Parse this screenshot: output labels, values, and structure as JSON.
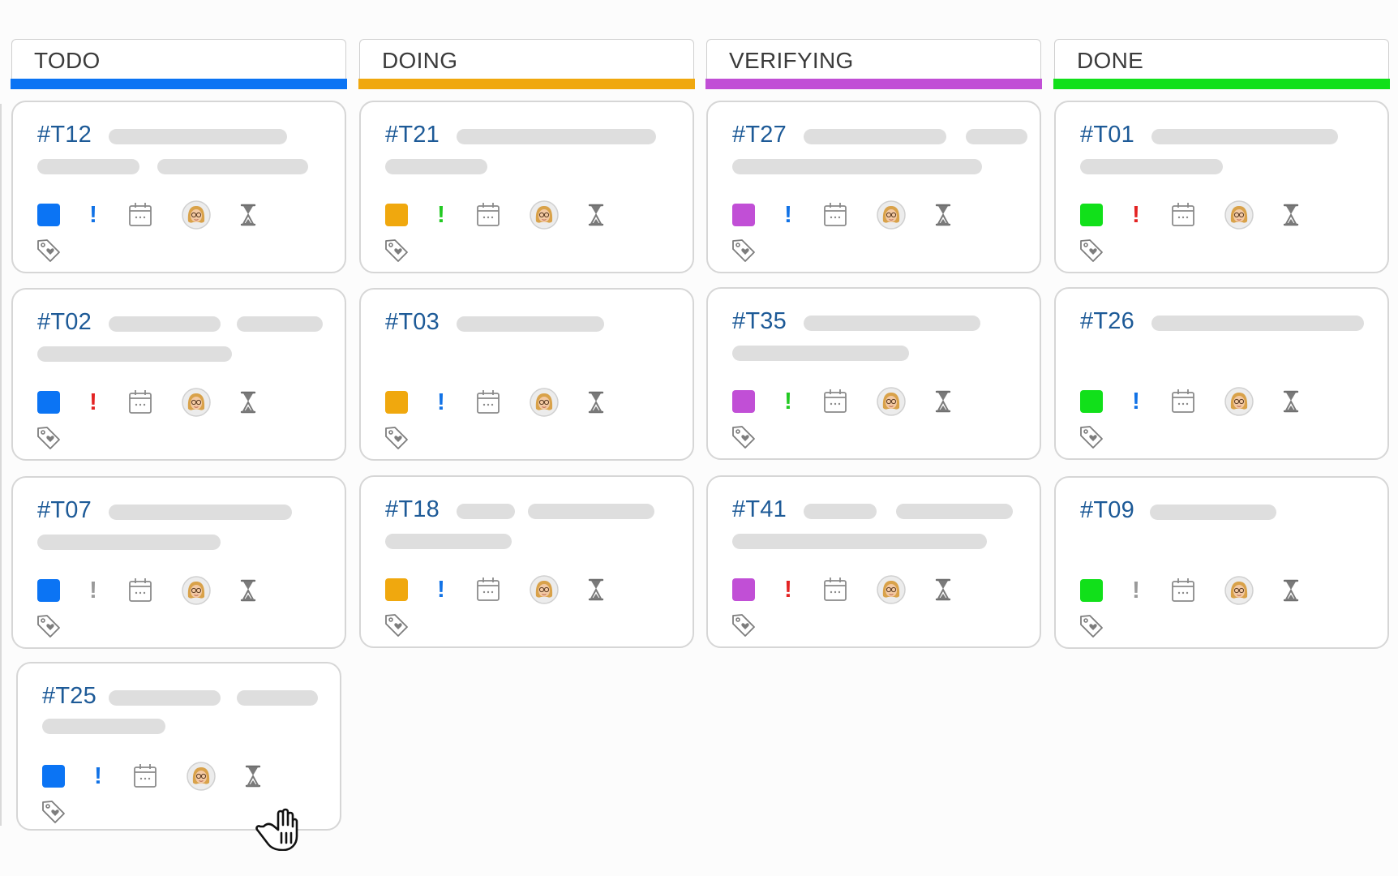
{
  "columns": [
    {
      "title": "TODO",
      "color": "#0b74f4"
    },
    {
      "title": "DOING",
      "color": "#f0a80e"
    },
    {
      "title": "VERIFYING",
      "color": "#c14fd6"
    },
    {
      "title": "DONE",
      "color": "#11e01a"
    }
  ],
  "cards": [
    {
      "id": "#T12",
      "priority_color": "#1172e6"
    },
    {
      "id": "#T02",
      "priority_color": "#e32323"
    },
    {
      "id": "#T07",
      "priority_color": "#9a9a9a"
    },
    {
      "id": "#T25",
      "priority_color": "#1172e6"
    },
    {
      "id": "#T21",
      "priority_color": "#22c922"
    },
    {
      "id": "#T03",
      "priority_color": "#1172e6"
    },
    {
      "id": "#T18",
      "priority_color": "#1172e6"
    },
    {
      "id": "#T27",
      "priority_color": "#1172e6"
    },
    {
      "id": "#T35",
      "priority_color": "#22c922"
    },
    {
      "id": "#T41",
      "priority_color": "#e32323"
    },
    {
      "id": "#T01",
      "priority_color": "#e32323"
    },
    {
      "id": "#T26",
      "priority_color": "#1172e6"
    },
    {
      "id": "#T09",
      "priority_color": "#9a9a9a"
    }
  ],
  "icons": {
    "priority": "exclamation-icon",
    "date": "calendar-icon",
    "assignee": "avatar",
    "time": "hourglass-icon",
    "labels": "tag-heart-icon",
    "cursor": "grab-hand-cursor-icon"
  }
}
